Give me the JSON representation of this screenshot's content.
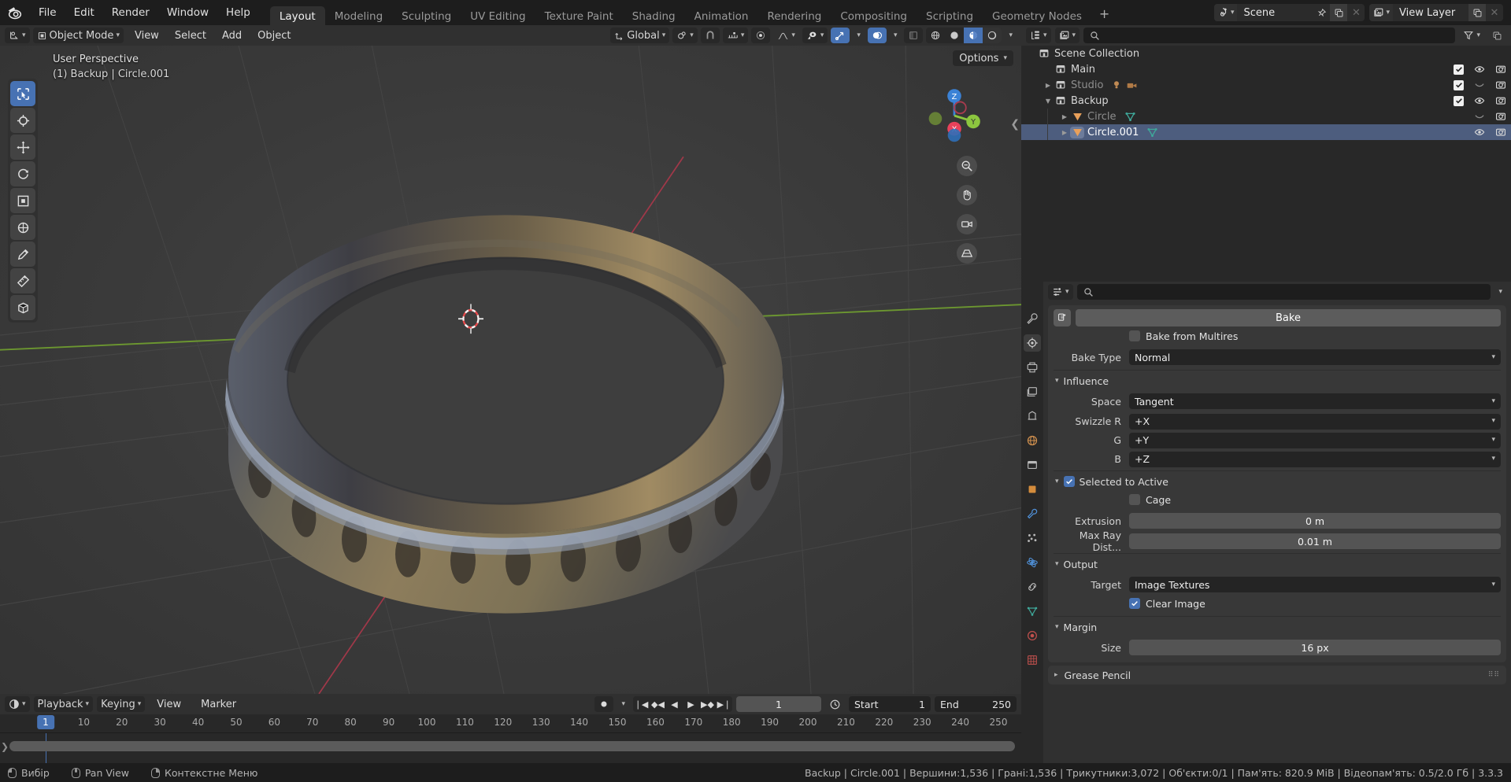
{
  "app": {
    "logo_icon": "blender-logo",
    "menus": [
      "File",
      "Edit",
      "Render",
      "Window",
      "Help"
    ],
    "workspace_tabs": [
      {
        "label": "Layout",
        "active": true
      },
      {
        "label": "Modeling",
        "active": false
      },
      {
        "label": "Sculpting",
        "active": false
      },
      {
        "label": "UV Editing",
        "active": false
      },
      {
        "label": "Texture Paint",
        "active": false
      },
      {
        "label": "Shading",
        "active": false
      },
      {
        "label": "Animation",
        "active": false
      },
      {
        "label": "Rendering",
        "active": false
      },
      {
        "label": "Compositing",
        "active": false
      },
      {
        "label": "Scripting",
        "active": false
      },
      {
        "label": "Geometry Nodes",
        "active": false
      }
    ],
    "add_workspace_label": "+",
    "scene": {
      "name": "Scene",
      "icon": "scene-icon",
      "pin_icon": "pin-icon",
      "copy_icon": "new-scene-icon",
      "close_icon": "unlink-icon"
    },
    "view_layer": {
      "name": "View Layer",
      "icon": "view-layer-icon",
      "copy_icon": "new-view-layer-icon",
      "close_icon": "remove-view-layer-icon"
    }
  },
  "viewport_header": {
    "editor_type_icon": "editor-type-3dview-icon",
    "mode": "Object Mode",
    "mode_icon": "object-mode-icon",
    "menus": [
      "View",
      "Select",
      "Add",
      "Object"
    ],
    "transform_orientation": "Global",
    "orientation_icon": "orientation-global-icon",
    "snap_icon": "magnet-icon",
    "snap_target_icon": "snap-increment-icon",
    "proportional_icon": "proportional-edit-icon",
    "falloff_icon": "smooth-falloff-icon",
    "visibility_icon": "object-visibility-icon",
    "gizmo_icon": "gizmo-icon",
    "overlays_icon": "overlays-icon",
    "xray_icon": "xray-icon",
    "shading_modes": [
      {
        "icon": "wireframe-icon",
        "active": false
      },
      {
        "icon": "solid-icon",
        "active": false
      },
      {
        "icon": "material-preview-icon",
        "active": true
      },
      {
        "icon": "rendered-icon",
        "active": false
      }
    ],
    "options_label": "Options"
  },
  "viewport": {
    "perspective_label": "User Perspective",
    "scene_info": "(1) Backup | Circle.001",
    "gizmo_axes": [
      {
        "label": "Z",
        "color": "#3b82d6"
      },
      {
        "label": "Y",
        "color": "#8cc63f"
      },
      {
        "label": "X",
        "color": "#e8425b"
      }
    ],
    "nav_icons": [
      "zoom-icon",
      "pan-hand-icon",
      "camera-view-icon",
      "toggle-perspective-icon"
    ],
    "collapse_icon": "collapse-sidebar-icon",
    "tools": [
      {
        "icon": "tweak-select-box-icon",
        "active": true
      },
      {
        "icon": "cursor-3d-icon",
        "active": false
      },
      {
        "icon": "move-icon",
        "active": false
      },
      {
        "icon": "rotate-icon",
        "active": false
      },
      {
        "icon": "scale-icon",
        "active": false
      },
      {
        "icon": "transform-icon",
        "active": false
      },
      {
        "icon": "annotate-icon",
        "active": false
      },
      {
        "icon": "measure-icon",
        "active": false
      },
      {
        "icon": "add-cube-icon",
        "active": false
      }
    ]
  },
  "timeline": {
    "editor_type_icon": "editor-type-timeline-icon",
    "menus": [
      "Playback",
      "Keying",
      "View",
      "Marker"
    ],
    "keying_set_icon": "record-icon",
    "transport_icons": [
      "jump-start-icon",
      "prev-keyframe-icon",
      "play-reverse-icon",
      "play-icon",
      "next-keyframe-icon",
      "jump-end-icon"
    ],
    "current_frame": "1",
    "auto_key_icon": "auto-keying-icon",
    "start_label": "Start",
    "start_value": "1",
    "end_label": "End",
    "end_value": "250",
    "ruler_ticks": [
      "1",
      "10",
      "20",
      "30",
      "40",
      "50",
      "60",
      "70",
      "80",
      "90",
      "100",
      "110",
      "120",
      "130",
      "140",
      "150",
      "160",
      "170",
      "180",
      "190",
      "200",
      "210",
      "220",
      "230",
      "240",
      "250"
    ],
    "playhead_frame": "1"
  },
  "outliner": {
    "display_mode_icon": "outliner-display-mode-icon",
    "filter_id_icon": "outliner-id-type-icon",
    "search_placeholder": "",
    "search_icon": "search-icon",
    "filter_icon": "filter-funnel-icon",
    "rows": [
      {
        "name": "Scene Collection",
        "icon": "collection-icon",
        "indent": 0,
        "disclosure": "none",
        "selected": false,
        "dim": false,
        "controls": []
      },
      {
        "name": "Main",
        "icon": "collection-icon",
        "indent": 1,
        "disclosure": "none",
        "selected": false,
        "dim": false,
        "controls": [
          "checkbox-on",
          "eye-open",
          "camera-on"
        ]
      },
      {
        "name": "Studio",
        "icon": "collection-icon",
        "indent": 1,
        "disclosure": "closed",
        "selected": false,
        "dim": true,
        "extra_icons": [
          "light-icon",
          "camera-data-icon"
        ],
        "controls": [
          "checkbox-on",
          "eye-closed",
          "camera-on"
        ]
      },
      {
        "name": "Backup",
        "icon": "collection-icon",
        "indent": 1,
        "disclosure": "open",
        "selected": false,
        "dim": false,
        "controls": [
          "checkbox-on",
          "eye-open",
          "camera-on"
        ]
      },
      {
        "name": "Circle",
        "icon": "mesh-object-icon",
        "indent": 2,
        "disclosure": "closed",
        "selected": false,
        "dim": true,
        "extra_icons": [
          "mesh-data-icon"
        ],
        "controls": [
          "eye-closed",
          "camera-on"
        ]
      },
      {
        "name": "Circle.001",
        "icon": "mesh-object-icon",
        "indent": 2,
        "disclosure": "closed",
        "selected": true,
        "dim": false,
        "extra_icons": [
          "mesh-data-icon"
        ],
        "controls": [
          "eye-open",
          "camera-on"
        ]
      }
    ]
  },
  "properties": {
    "header": {
      "editor_type_icon": "editor-type-properties-icon",
      "search_icon": "search-icon",
      "search_placeholder": "",
      "chevron_icon": "chevron-down-icon"
    },
    "tabs": [
      {
        "icon": "tool-icon",
        "active": false
      },
      {
        "icon": "render-icon",
        "active": true
      },
      {
        "icon": "output-icon",
        "active": false
      },
      {
        "icon": "view-layer-icon",
        "active": false
      },
      {
        "icon": "scene-properties-icon",
        "active": false
      },
      {
        "icon": "world-icon",
        "active": false
      },
      {
        "icon": "collection-properties-icon",
        "active": false
      },
      {
        "icon": "object-properties-icon",
        "active": false
      },
      {
        "icon": "modifier-wrench-icon",
        "active": false
      },
      {
        "icon": "particles-icon",
        "active": false
      },
      {
        "icon": "physics-icon",
        "active": false
      },
      {
        "icon": "constraints-icon",
        "active": false
      },
      {
        "icon": "object-data-icon",
        "active": false
      },
      {
        "icon": "material-icon",
        "active": false
      },
      {
        "icon": "texture-icon",
        "active": false
      }
    ],
    "bake_button": {
      "label": "Bake",
      "icon": "bake-icon"
    },
    "bake_from_multires": {
      "label": "Bake from Multires",
      "checked": false
    },
    "bake_type": {
      "label": "Bake Type",
      "value": "Normal"
    },
    "influence": {
      "title": "Influence",
      "space": {
        "label": "Space",
        "value": "Tangent"
      },
      "swizzle_r": {
        "label": "Swizzle R",
        "value": "+X"
      },
      "swizzle_g": {
        "label": "G",
        "value": "+Y"
      },
      "swizzle_b": {
        "label": "B",
        "value": "+Z"
      }
    },
    "selected_to_active": {
      "title": "Selected to Active",
      "checked": true,
      "cage": {
        "label": "Cage",
        "checked": false
      },
      "extrusion": {
        "label": "Extrusion",
        "value": "0 m"
      },
      "max_ray_distance": {
        "label": "Max Ray Dist...",
        "value": "0.01 m"
      }
    },
    "output": {
      "title": "Output",
      "target": {
        "label": "Target",
        "value": "Image Textures"
      },
      "clear_image": {
        "label": "Clear Image",
        "checked": true
      }
    },
    "margin": {
      "title": "Margin",
      "size": {
        "label": "Size",
        "value": "16 px"
      }
    },
    "grease_pencil": {
      "title": "Grease Pencil"
    }
  },
  "statusbar": {
    "left_items": [
      {
        "icon": "mouse-left-icon",
        "label": "Вибір"
      },
      {
        "icon": "mouse-middle-icon",
        "label": "Pan View"
      },
      {
        "icon": "mouse-right-icon",
        "label": "Контекстне Меню"
      }
    ],
    "stats": "Backup | Circle.001 | Вершини:1,536 | Грані:1,536 | Трикутники:3,072 | Об'єкти:0/1 | Пам'ять: 820.9 MiB | Відеопам'ять: 0.5/2.0 Гб | 3.3.3"
  },
  "colors": {
    "accent_blue": "#4772b3",
    "selection_row": "#4d5d7e",
    "panel_bg": "#383838",
    "editor_bg": "#303030",
    "window_bg": "#1d1d1d",
    "mesh_orange": "#e9a05a",
    "mesh_data_teal": "#3fa89a"
  }
}
